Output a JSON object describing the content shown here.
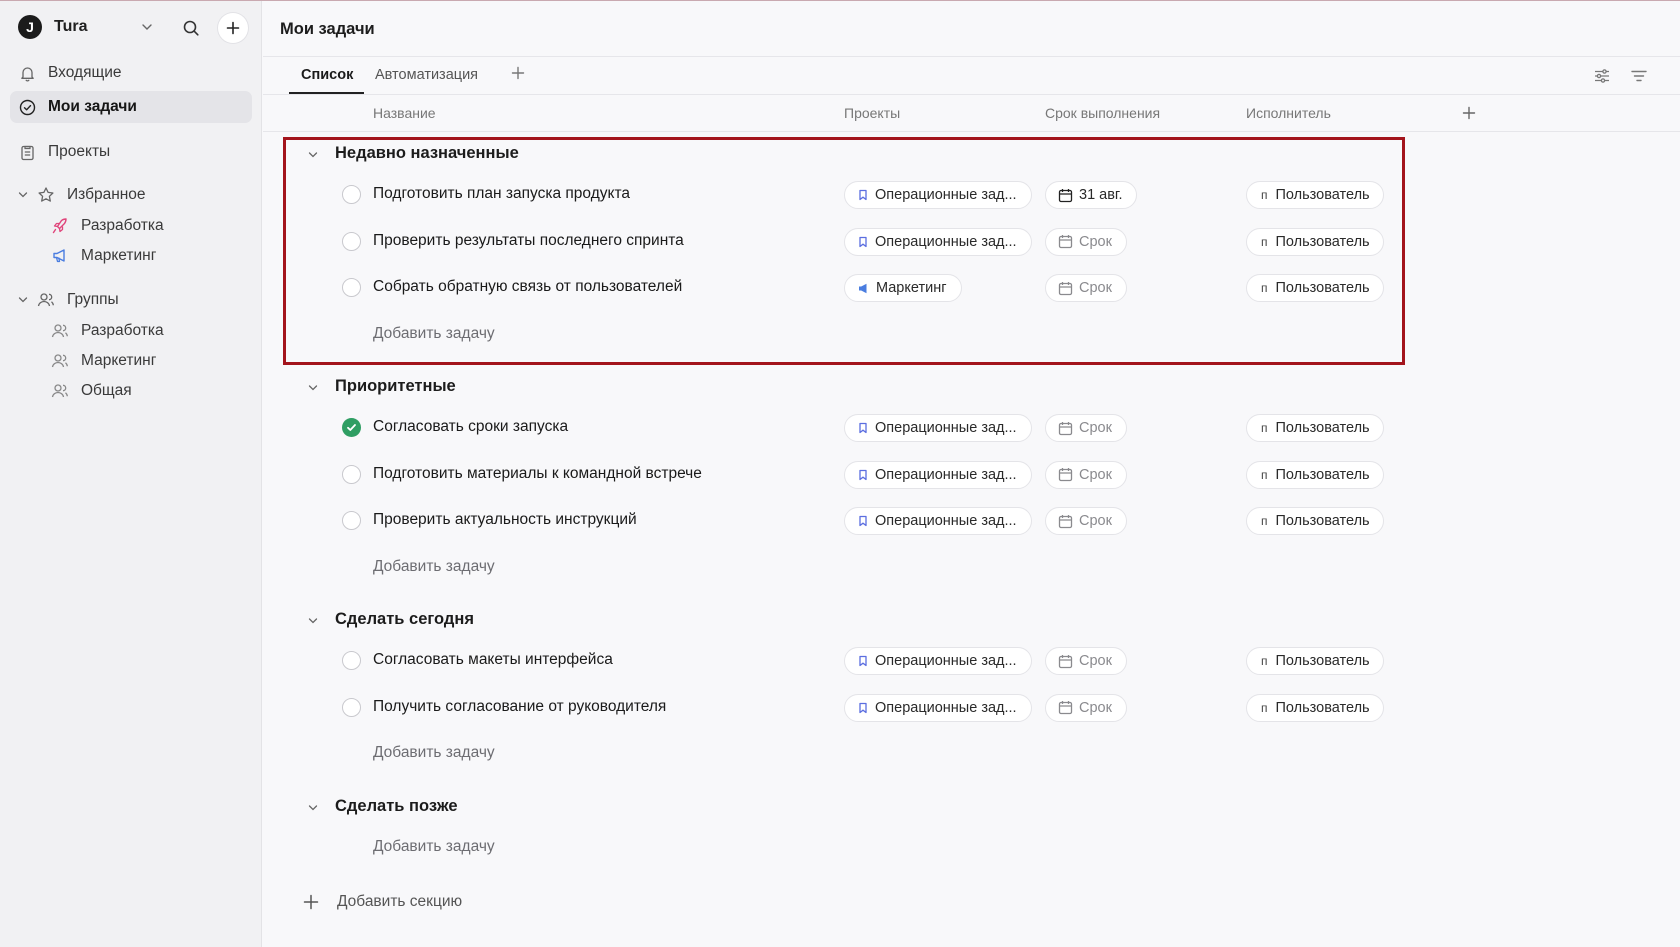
{
  "workspace": {
    "logo": "J",
    "name": "Tura"
  },
  "sidebar": {
    "inbox": "Входящие",
    "my_tasks": "Мои задачи",
    "projects": "Проекты",
    "favorites": {
      "label": "Избранное",
      "items": [
        "Разработка",
        "Маркетинг"
      ]
    },
    "groups": {
      "label": "Группы",
      "items": [
        "Разработка",
        "Маркетинг",
        "Общая"
      ]
    }
  },
  "main": {
    "title": "Мои задачи",
    "tabs": [
      "Список",
      "Автоматизация"
    ],
    "columns": [
      "Название",
      "Проекты",
      "Срок выполнения",
      "Исполнитель"
    ]
  },
  "sections": [
    {
      "title": "Недавно назначенные",
      "tasks": [
        {
          "name": "Подготовить план запуска продукта",
          "project": "Операционные зад...",
          "due": "31 авг.",
          "assignee_initial": "п",
          "assignee": "Пользователь"
        },
        {
          "name": "Проверить результаты последнего спринта",
          "project": "Операционные зад...",
          "due": "Срок",
          "assignee_initial": "п",
          "assignee": "Пользователь"
        },
        {
          "name": "Собрать обратную связь от пользователей",
          "project": "Маркетинг",
          "due": "Срок",
          "assignee_initial": "п",
          "assignee": "Пользователь"
        }
      ],
      "add_task": "Добавить задачу"
    },
    {
      "title": "Приоритетные",
      "tasks": [
        {
          "name": "Согласовать сроки запуска",
          "project": "Операционные зад...",
          "due": "Срок",
          "assignee_initial": "п",
          "assignee": "Пользователь"
        },
        {
          "name": "Подготовить материалы к командной встрече",
          "project": "Операционные зад...",
          "due": "Срок",
          "assignee_initial": "п",
          "assignee": "Пользователь"
        },
        {
          "name": "Проверить актуальность инструкций",
          "project": "Операционные зад...",
          "due": "Срок",
          "assignee_initial": "п",
          "assignee": "Пользователь"
        }
      ],
      "add_task": "Добавить задачу"
    },
    {
      "title": "Сделать сегодня",
      "tasks": [
        {
          "name": "Согласовать макеты интерфейса",
          "project": "Операционные зад...",
          "due": "Срок",
          "assignee_initial": "п",
          "assignee": "Пользователь"
        },
        {
          "name": "Получить согласование от руководителя",
          "project": "Операционные зад...",
          "due": "Срок",
          "assignee_initial": "п",
          "assignee": "Пользователь"
        }
      ],
      "add_task": "Добавить задачу"
    },
    {
      "title": "Сделать позже",
      "tasks": [],
      "add_task": "Добавить задачу"
    }
  ],
  "add_section": "Добавить секцию",
  "colors": {
    "accent_done": "#2f9e63",
    "highlight_border": "#a3141c",
    "favorite_dev": "#e0457b",
    "favorite_marketing": "#4a7de0"
  }
}
